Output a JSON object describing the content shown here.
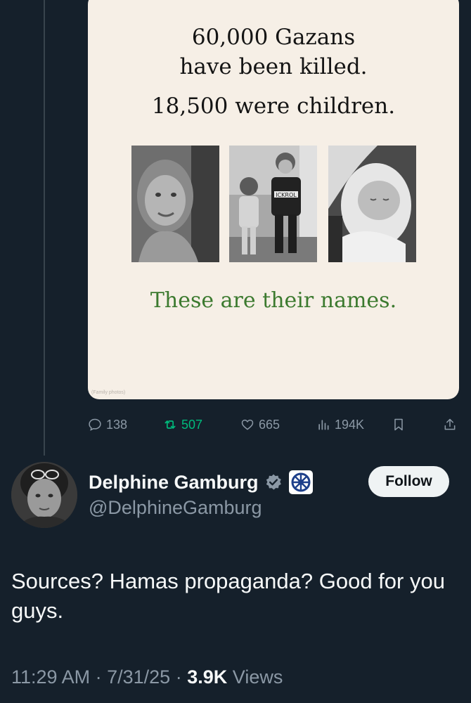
{
  "quoted_post": {
    "headline_1": "60,000 Gazans",
    "headline_2": "have been killed.",
    "headline_3": "18,500 were children.",
    "tagline": "These are their names.",
    "photo_credit": "(Family photos)",
    "sweater_text": "ICKROL"
  },
  "actions": {
    "replies": "138",
    "reposts": "507",
    "likes": "665",
    "views": "194K"
  },
  "reply": {
    "display_name": "Delphine Gamburg",
    "handle": "@DelphineGamburg",
    "follow_label": "Follow",
    "text": "Sources? Hamas propaganda? Good for you guys.",
    "time": "11:29 AM",
    "date": "7/31/25",
    "views_count": "3.9K",
    "views_label": "Views",
    "separator": "·"
  },
  "colors": {
    "background": "#15202b",
    "verified_badge": "#8b98a5",
    "repost_green": "#00ba7c",
    "tagline_green": "#3c7a2f"
  }
}
